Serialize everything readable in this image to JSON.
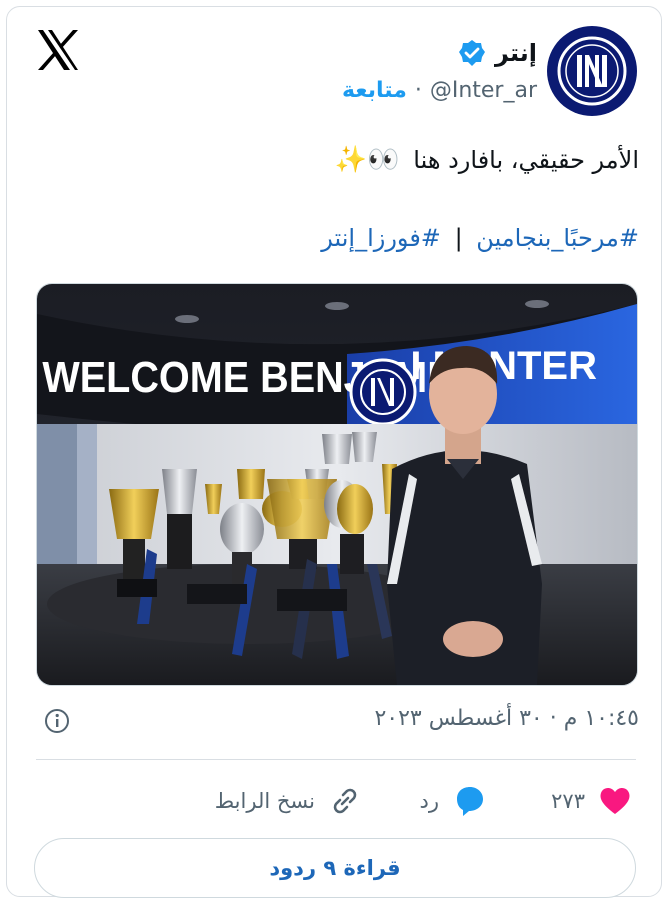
{
  "account": {
    "name": "إنتر",
    "handle": "@Inter_ar",
    "separator": "·",
    "follow_label": "متابعة"
  },
  "tweet": {
    "text": "الأمر حقيقي، بافارد هنا",
    "emoji": "👀✨",
    "hashtag_1": "#مرحبًا_بنجامين",
    "hashtag_sep": "|",
    "hashtag_2": "#فورزا_إنتر"
  },
  "photo": {
    "banner_left": "WELCOME BENJAMIN",
    "banner_right": "I M INTER"
  },
  "meta": {
    "timestamp": "١٠:٤٥ م · ٣٠ أغسطس ٢٠٢٣"
  },
  "actions": {
    "like_count": "٢٧٣",
    "reply_label": "رد",
    "copy_label": "نسخ الرابط"
  },
  "footer": {
    "read_replies": "قراءة ٩ ردود"
  },
  "colors": {
    "accent": "#1d9bf0",
    "like": "#f91880",
    "inter_blue": "#0b1a72"
  }
}
